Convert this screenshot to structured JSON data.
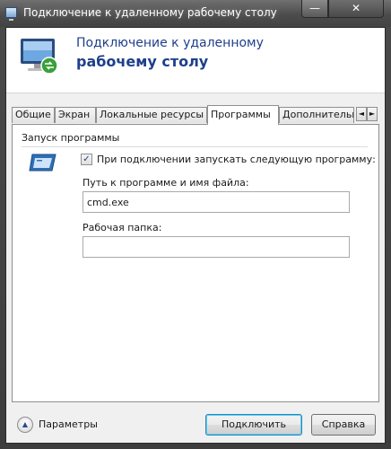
{
  "window": {
    "title": "Подключение к удаленному рабочему столу",
    "minimize_glyph": "—",
    "close_glyph": "✕"
  },
  "banner": {
    "line1": "Подключение к удаленному",
    "line2": "рабочему столу",
    "icon": "remote-desktop-icon"
  },
  "tabs": [
    {
      "label": "Общие"
    },
    {
      "label": "Экран"
    },
    {
      "label": "Локальные ресурсы"
    },
    {
      "label": "Программы",
      "active": true
    },
    {
      "label": "Дополнительно"
    }
  ],
  "tab_scroll": {
    "left": "◄",
    "right": "►"
  },
  "programs": {
    "group_title": "Запуск программы",
    "icon": "program-window-icon",
    "checkbox_checked": true,
    "checkbox_glyph": "✓",
    "checkbox_label": "При подключении запускать следующую программу:",
    "path_label": "Путь к программе и имя файла:",
    "path_value": "cmd.exe",
    "folder_label": "Рабочая папка:",
    "folder_value": ""
  },
  "footer": {
    "params_glyph": "▲",
    "params_label": "Параметры",
    "connect_label": "Подключить",
    "help_label": "Справка"
  }
}
